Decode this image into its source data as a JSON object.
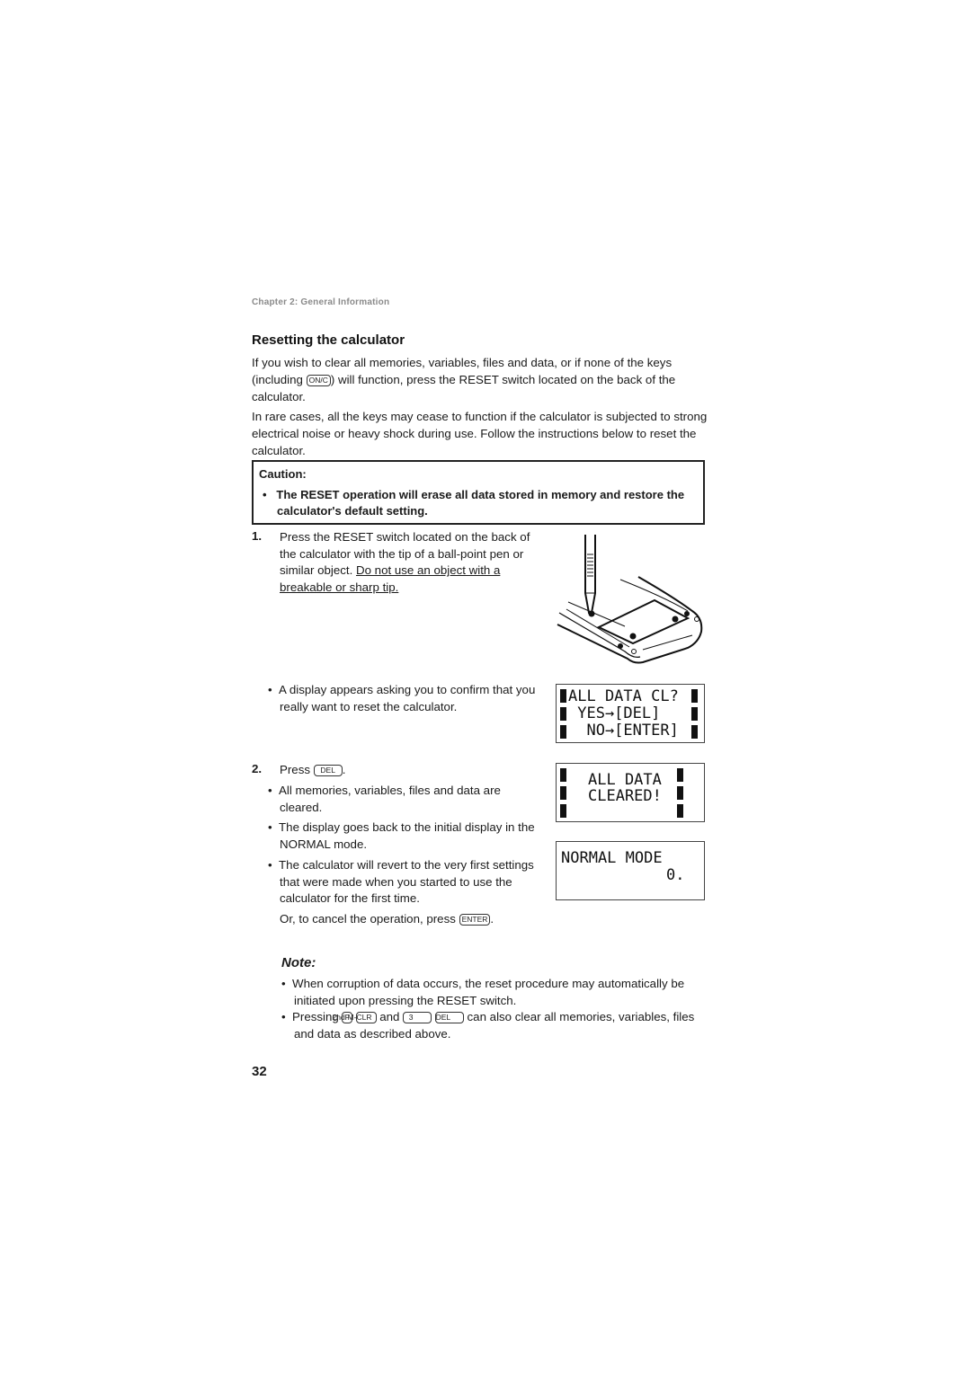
{
  "header": {
    "chapter": "Chapter 2: General Information"
  },
  "section": {
    "title": "Resetting the calculator",
    "intro_p1_before": "If you wish to clear all memories, variables, files and data, or if none of the keys (including ",
    "intro_p1_key": "ON/C",
    "intro_p1_after": ") will function, press the RESET switch located on the back of the calculator.",
    "intro_p2": "In rare cases, all the keys may cease to function if the calculator is subjected to strong electrical noise or heavy shock during use. Follow the instructions below to reset the calculator."
  },
  "caution": {
    "title": "Caution:",
    "bullet": "•",
    "item": "The RESET operation will erase all data stored in memory and restore the calculator's default setting."
  },
  "steps": {
    "step1": {
      "number": "1.",
      "text_plain": "Press the RESET switch located on the back of the calculator with the tip of a ball-point pen or similar object. ",
      "text_underlined": "Do not use an object with a breakable or sharp tip."
    },
    "step1_bullet": "A display appears asking you to confirm that you really want to reset the calculator.",
    "step2": {
      "number": "2.",
      "press_label": "Press ",
      "key": "DEL",
      "suffix": "."
    },
    "step2_bullets": [
      "All memories, variables, files and data are cleared.",
      "The display goes back to the initial display in the NORMAL mode.",
      "The calculator will revert to the very first settings that were made when you started to use the calculator for the first time."
    ],
    "cancel_before": "Or, to cancel the operation, press ",
    "cancel_key": "ENTER",
    "cancel_after": "."
  },
  "displays": {
    "confirm": {
      "lines": [
        "ALL DATA CL?",
        " YES→[DEL]",
        "  NO→[ENTER]"
      ]
    },
    "cleared": {
      "lines": [
        "ALL DATA",
        "CLEARED!"
      ]
    },
    "normal": {
      "line1": "NORMAL MODE",
      "value": "0."
    }
  },
  "note": {
    "title": "Note:",
    "item1": "When corruption of data occurs, the reset procedure may automatically be initiated upon pressing the RESET switch.",
    "item2_before": "Pressing ",
    "item2_keys": [
      "2ndF",
      "M-CLR",
      "3",
      "DEL"
    ],
    "item2_and": " and ",
    "item2_after": " can also clear all memories, variables, files and data as described above."
  },
  "footer": {
    "page_number": "32"
  }
}
